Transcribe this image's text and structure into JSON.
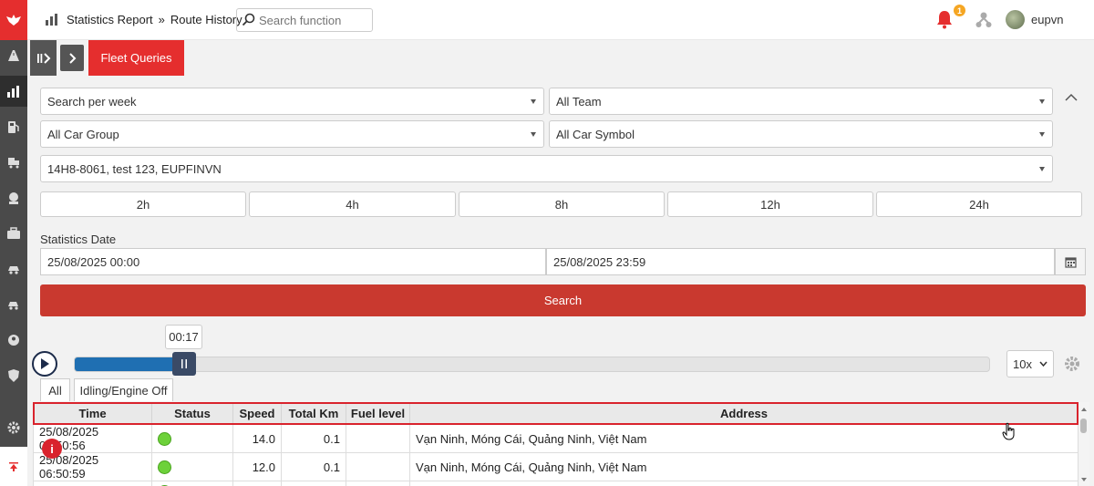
{
  "header": {
    "breadcrumb_1": "Statistics Report",
    "breadcrumb_sep": "»",
    "breadcrumb_2": "Route History",
    "search_placeholder": "Search function",
    "notification_count": "1",
    "username": "eupvn"
  },
  "tabs": {
    "active": "Fleet Queries"
  },
  "filters": {
    "period": "Search per week",
    "team": "All Team",
    "car_group": "All Car Group",
    "car_symbol": "All Car Symbol",
    "vehicles": "14H8-8061, test 123, EUPFINVN"
  },
  "hour_buttons": [
    "2h",
    "4h",
    "8h",
    "12h",
    "24h"
  ],
  "date": {
    "label": "Statistics Date",
    "from": "25/08/2025 00:00",
    "to": "25/08/2025 23:59"
  },
  "search_button": "Search",
  "playback": {
    "time": "00:17",
    "speed": "10x",
    "progress": 0.11
  },
  "view_tabs": [
    "All",
    "Idling/Engine Off"
  ],
  "table": {
    "columns": [
      "Time",
      "Status",
      "Speed",
      "Total Km",
      "Fuel level",
      "Address"
    ],
    "rows": [
      {
        "time": "25/08/2025 06:50:56",
        "speed": "14.0",
        "km": "0.1",
        "fuel": "",
        "address": "Vạn Ninh, Móng Cái, Quảng Ninh, Việt Nam"
      },
      {
        "time": "25/08/2025 06:50:59",
        "speed": "12.0",
        "km": "0.1",
        "fuel": "",
        "address": "Vạn Ninh, Móng Cái, Quảng Ninh, Việt Nam"
      }
    ]
  },
  "colors": {
    "accent": "#e52e2e",
    "search_button": "#c9392f",
    "sidebar": "#4a4a4a",
    "progress": "#1f6fb2",
    "status_ok": "#6dd13a"
  }
}
